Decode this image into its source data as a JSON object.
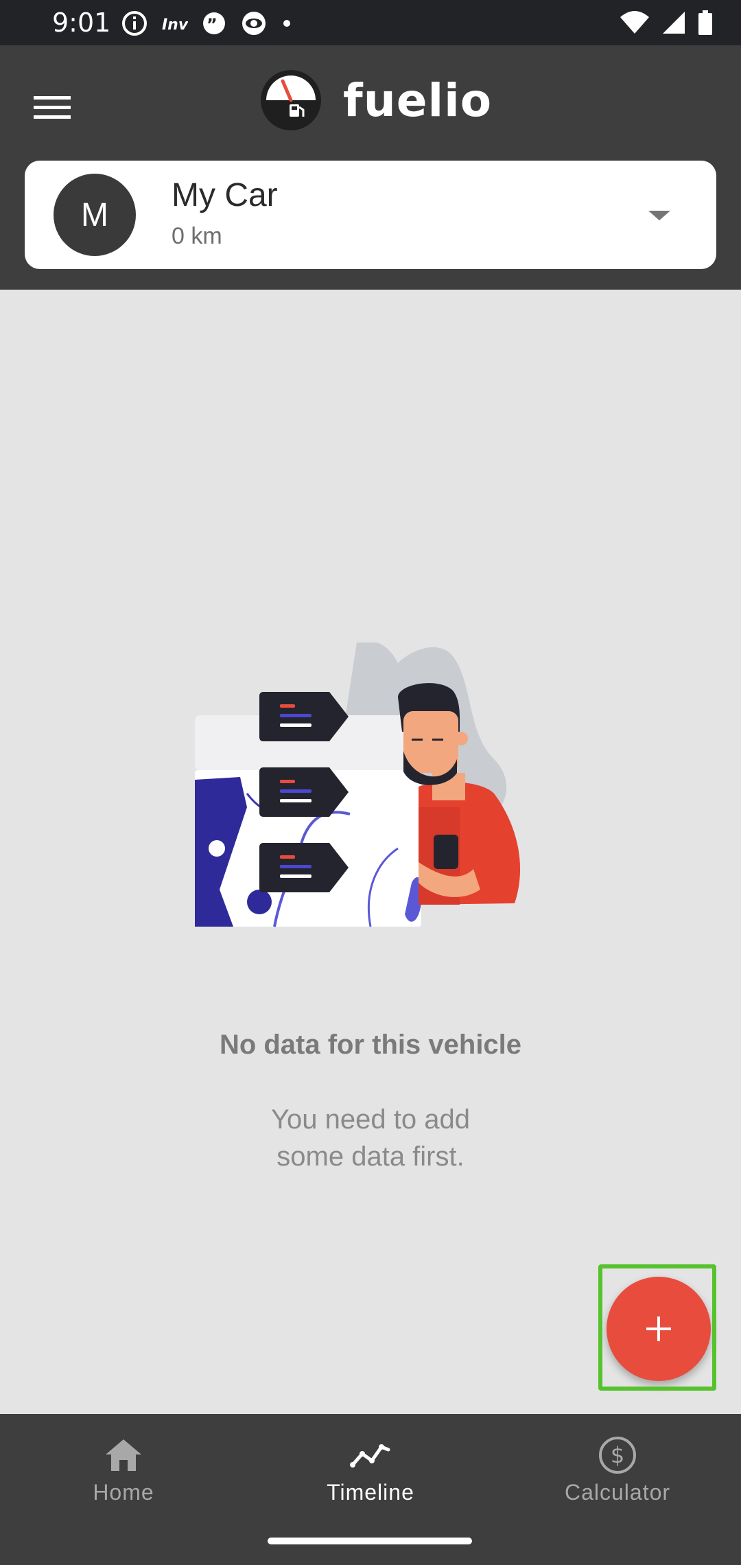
{
  "status_bar": {
    "time": "9:01",
    "left_icons": [
      "info-icon",
      "inv-icon",
      "quote-icon",
      "eye-icon",
      "dot-icon"
    ],
    "right_icons": [
      "wifi-icon",
      "signal-icon",
      "battery-icon"
    ]
  },
  "app_bar": {
    "logo_text": "fuelio",
    "menu_icon": "hamburger-menu-icon"
  },
  "vehicle": {
    "avatar_letter": "M",
    "name": "My Car",
    "odometer": "0 km"
  },
  "empty_state": {
    "title": "No data for this vehicle",
    "subtitle_line1": "You need to add",
    "subtitle_line2": "some data first."
  },
  "fab": {
    "icon": "plus-icon"
  },
  "bottom_nav": {
    "items": [
      {
        "label": "Home",
        "icon": "home-icon",
        "active": false
      },
      {
        "label": "Timeline",
        "icon": "timeline-icon",
        "active": true
      },
      {
        "label": "Calculator",
        "icon": "dollar-circle-icon",
        "active": false
      }
    ]
  },
  "colors": {
    "app_bar": "#3e3e3e",
    "status_bar": "#222326",
    "background": "#e4e4e4",
    "fab": "#e84c3d",
    "highlight": "#56c22e"
  }
}
